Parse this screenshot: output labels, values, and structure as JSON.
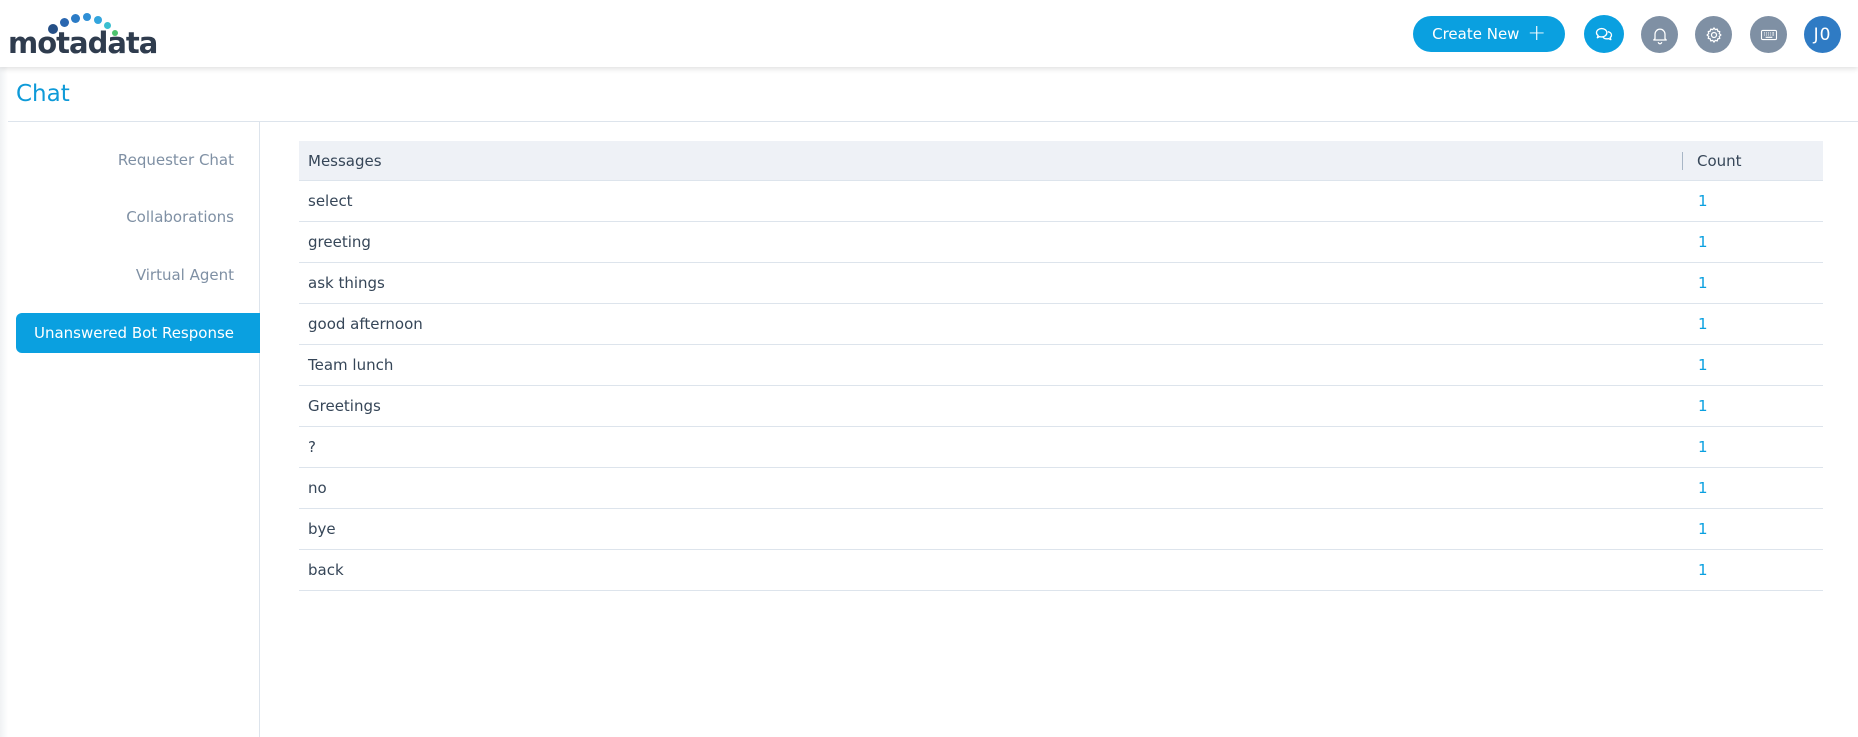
{
  "brand": {
    "logo_text": "motadata",
    "accent": "#0aa0e0",
    "icon_gray": "#7f90a4",
    "avatar_bg": "#2f7bc4"
  },
  "header": {
    "create_new_label": "Create New",
    "create_new_icon": "plus-icon",
    "icons": [
      "chat-icon",
      "bell-icon",
      "gear-icon",
      "keyboard-icon"
    ],
    "avatar_initials": "J0"
  },
  "page": {
    "title": "Chat"
  },
  "sidebar": {
    "items": [
      {
        "label": "Requester Chat",
        "active": false
      },
      {
        "label": "Collaborations",
        "active": false
      },
      {
        "label": "Virtual Agent",
        "active": false
      },
      {
        "label": "Unanswered Bot Response",
        "active": true
      }
    ]
  },
  "table": {
    "columns": [
      "Messages",
      "Count"
    ],
    "rows": [
      {
        "message": "select",
        "count": "1"
      },
      {
        "message": "greeting",
        "count": "1"
      },
      {
        "message": "ask things",
        "count": "1"
      },
      {
        "message": "good afternoon",
        "count": "1"
      },
      {
        "message": "Team lunch",
        "count": "1"
      },
      {
        "message": "Greetings",
        "count": "1"
      },
      {
        "message": "?",
        "count": "1"
      },
      {
        "message": "no",
        "count": "1"
      },
      {
        "message": "bye",
        "count": "1"
      },
      {
        "message": "back",
        "count": "1"
      }
    ]
  }
}
